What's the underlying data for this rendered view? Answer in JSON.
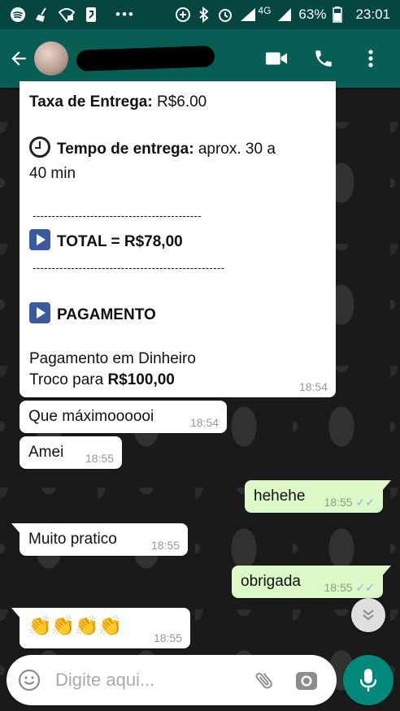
{
  "status_bar": {
    "network": "4G",
    "battery": "63%",
    "time": "23:01",
    "icons": [
      "spotify-icon",
      "broom-icon",
      "wifi-lock-icon",
      "phone-app-icon",
      "more-dots-icon",
      "data-saver-icon",
      "bluetooth-icon",
      "alarm-icon",
      "signal-icon",
      "battery-icon"
    ]
  },
  "header": {
    "contact_name": "",
    "icons": [
      "back-arrow-icon",
      "avatar",
      "video-call-icon",
      "phone-icon",
      "menu-dots-icon"
    ]
  },
  "order": {
    "fee_label": "Taxa de Entrega:",
    "fee_value": " R$6.00",
    "time_label": "Tempo de entrega:",
    "time_value_1": " aprox. 30 a",
    "time_value_2": "40 min",
    "divider_1": "--------------------------------------------",
    "total": "TOTAL = R$78,00",
    "divider_2": "--------------------------------------------------",
    "payment_title": "PAGAMENTO",
    "payment_method": "Pagamento em Dinheiro",
    "change_label": "Troco para ",
    "change_value": "R$100,00",
    "time": "18:54"
  },
  "messages": [
    {
      "text": "Que máximoooooi",
      "time": "18:54"
    },
    {
      "text": "Amei",
      "time": "18:55"
    },
    {
      "text": "hehehe",
      "time": "18:55"
    },
    {
      "text": "Muito pratico",
      "time": "18:55"
    },
    {
      "text": "obrigada",
      "time": "18:55"
    },
    {
      "text": "👏👏👏👏",
      "time": "18:55"
    }
  ],
  "input": {
    "placeholder": "Digite aqui..."
  },
  "colors": {
    "header": "#075e54",
    "status_bar": "#054740",
    "outgoing_bubble": "#dcf8c6",
    "incoming_bubble": "#ffffff",
    "mic_button": "#00897b"
  }
}
